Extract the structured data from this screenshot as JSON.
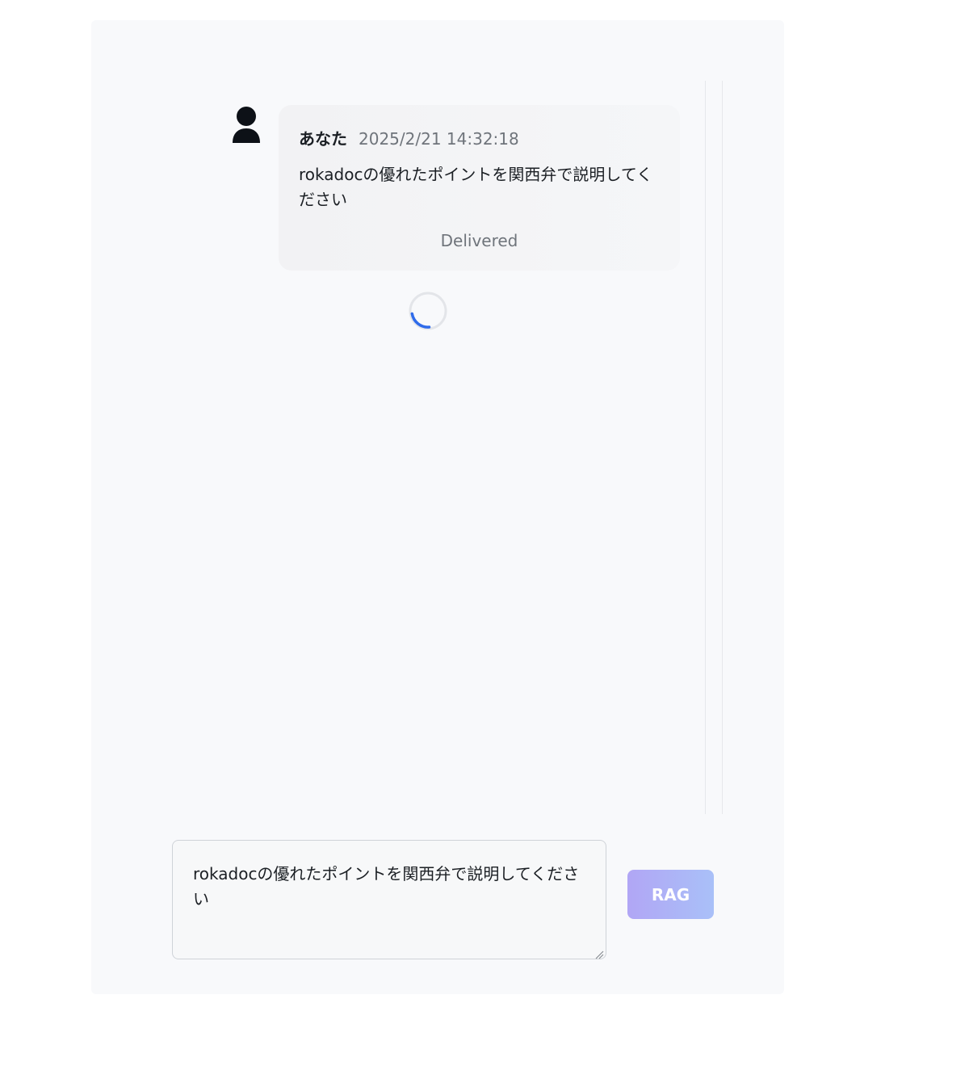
{
  "chat": {
    "messages": [
      {
        "sender": "あなた",
        "timestamp": "2025/2/21 14:32:18",
        "text": "rokadocの優れたポイントを関西弁で説明してください",
        "status": "Delivered",
        "avatar_icon": "user-icon"
      }
    ],
    "loading": true,
    "loading_icon": "spinner-icon"
  },
  "composer": {
    "value": "rokadocの優れたポイントを関西弁で説明してください",
    "submit_label": "RAG"
  },
  "colors": {
    "accent": "#2f6bea",
    "button_gradient_start": "#b1a6f5",
    "button_gradient_end": "#a9c0f8",
    "panel_bg": "#f8f9fb"
  }
}
